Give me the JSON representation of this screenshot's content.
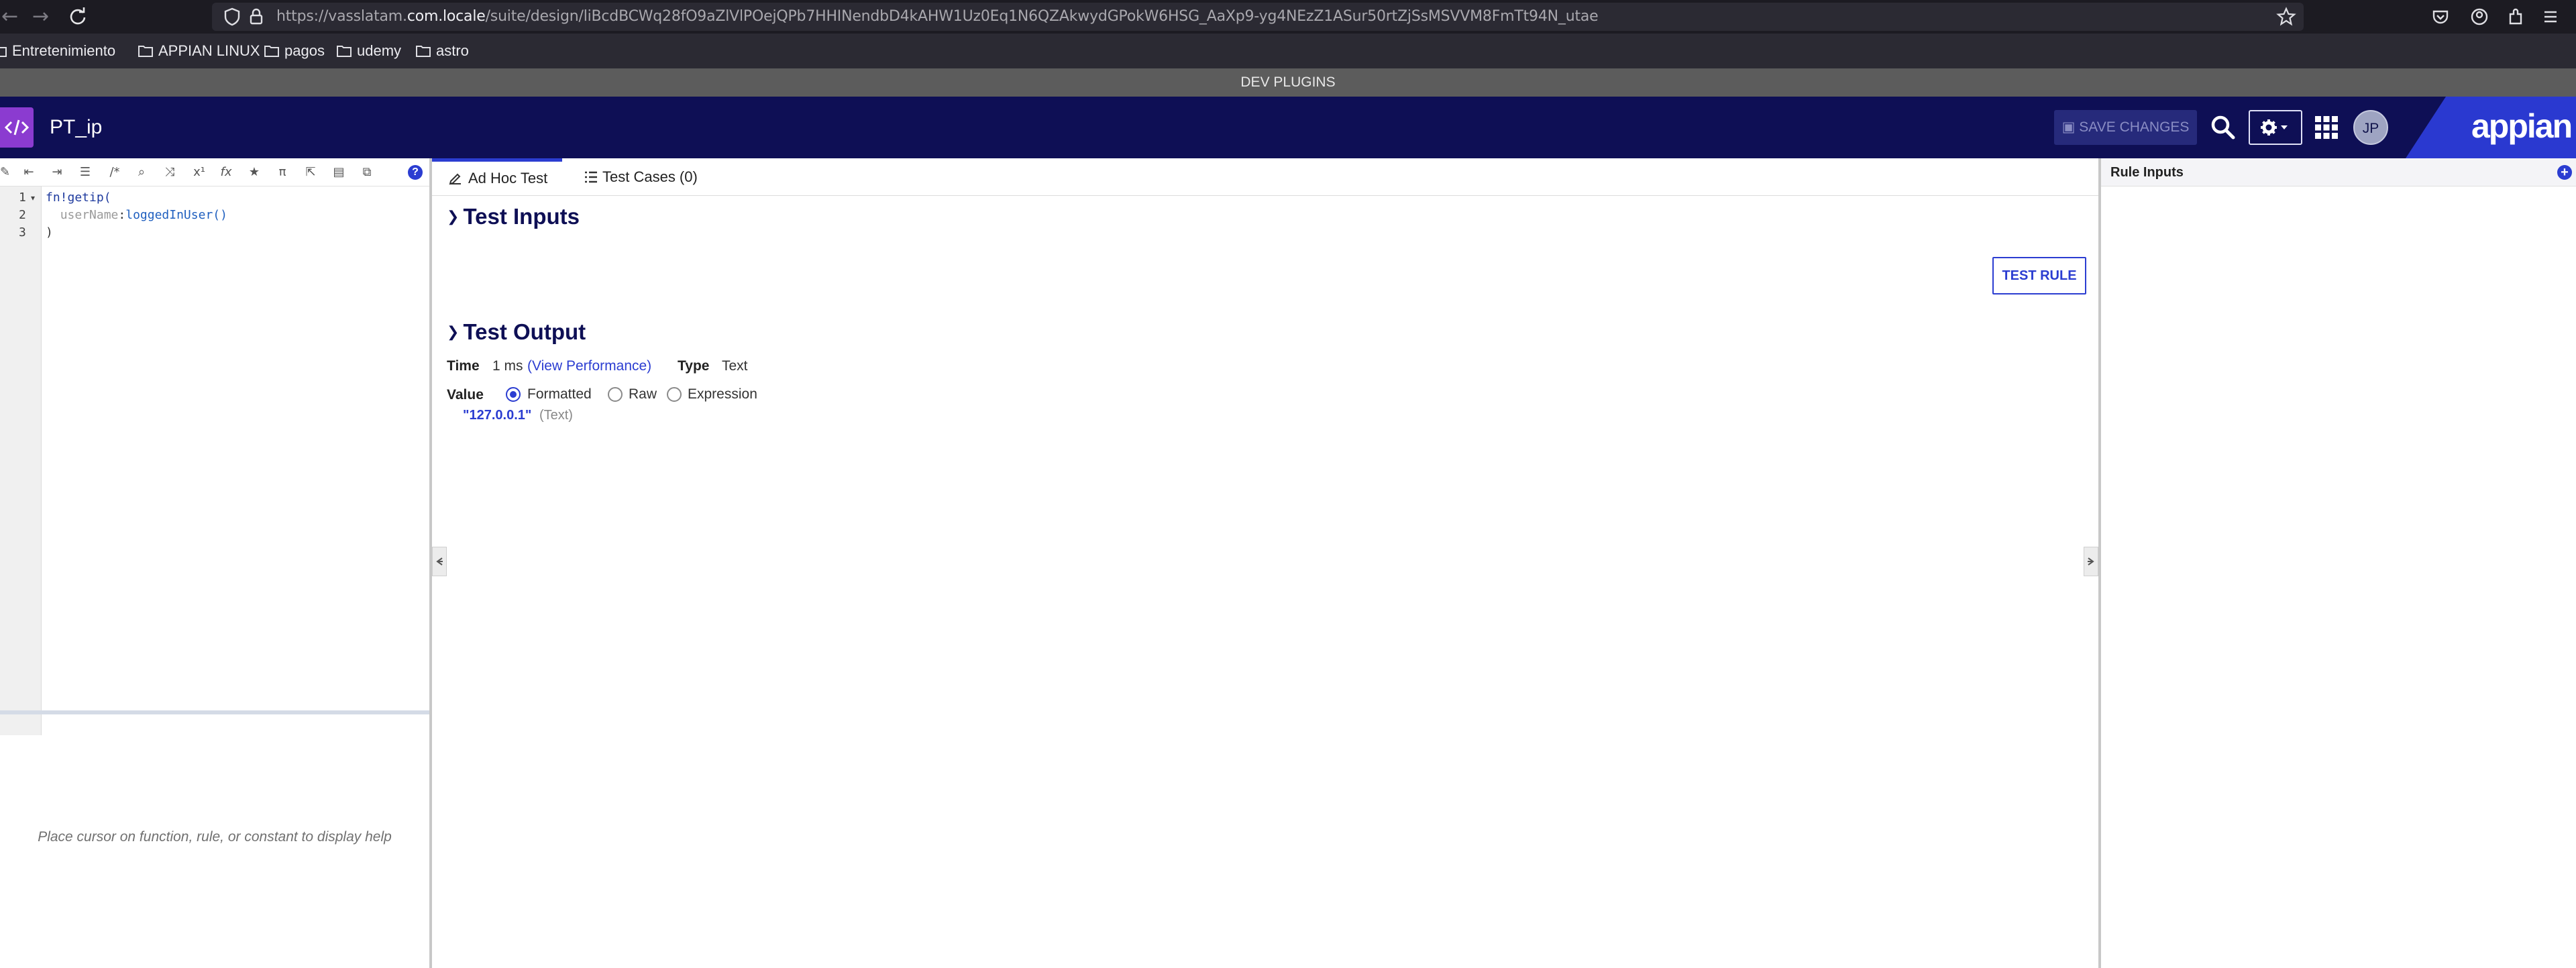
{
  "browser": {
    "url_prefix": "https://vasslatam.",
    "url_host": "com.locale",
    "url_rest": "/suite/design/liBcdBCWq28fO9aZlVlPOejQPb7HHINendbD4kAHW1Uz0Eq1N6QZAkwydGPokW6HSG_AaXp9-yg4NEzZ1ASur50rtZjSsMSVVM8FmTt94N_utae",
    "bookmarks": [
      "Entretenimiento",
      "APPIAN LINUX",
      "pagos",
      "udemy",
      "astro"
    ]
  },
  "banner": {
    "text": "DEV PLUGINS"
  },
  "header": {
    "rule_name": "PT_ip",
    "save_label": "SAVE CHANGES",
    "avatar_initials": "JP",
    "logo_text": "appian",
    "colors": {
      "bar": "#0e0f55",
      "accent": "#2b3dd1",
      "badge": "#8b3bd0"
    }
  },
  "editor": {
    "line_numbers": [
      "1",
      "2",
      "3"
    ],
    "line1": "fn!getip(",
    "line2_key": "userName",
    "line2_colon": ":",
    "line2_call": "loggedInUser()",
    "line3": ")",
    "help_text": "Place cursor on function, rule, or constant to display help"
  },
  "tabs": {
    "adhoc": "Ad Hoc Test",
    "cases": "Test Cases (0)"
  },
  "test_inputs": {
    "title": "Test Inputs",
    "button": "TEST RULE"
  },
  "test_output": {
    "title": "Test Output",
    "time_label": "Time",
    "time_value": "1 ms",
    "perf_link": "(View Performance)",
    "type_label": "Type",
    "type_value": "Text",
    "value_label": "Value",
    "options": [
      "Formatted",
      "Raw",
      "Expression"
    ],
    "selected_option": "Formatted",
    "result_value": "\"127.0.0.1\"",
    "result_type": "(Text)"
  },
  "rule_inputs": {
    "title": "Rule Inputs"
  }
}
